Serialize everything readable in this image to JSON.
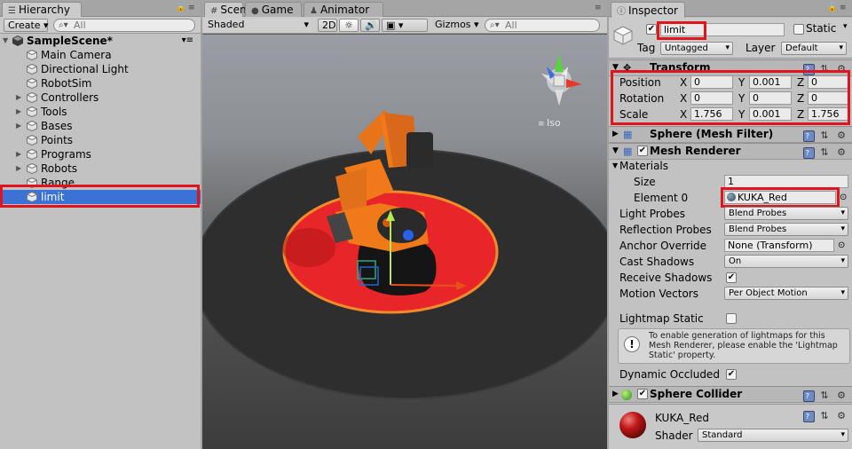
{
  "hierarchy": {
    "tab_label": "Hierarchy",
    "create_label": "Create",
    "search_placeholder": "All",
    "scene_name": "SampleScene*",
    "items": [
      {
        "label": "Main Camera",
        "has_children": false
      },
      {
        "label": "Directional Light",
        "has_children": false
      },
      {
        "label": "RobotSim",
        "has_children": false
      },
      {
        "label": "Controllers",
        "has_children": true
      },
      {
        "label": "Tools",
        "has_children": true
      },
      {
        "label": "Bases",
        "has_children": true
      },
      {
        "label": "Points",
        "has_children": false
      },
      {
        "label": "Programs",
        "has_children": true
      },
      {
        "label": "Robots",
        "has_children": true
      },
      {
        "label": "Range",
        "has_children": false
      },
      {
        "label": "limit",
        "has_children": false,
        "selected": true
      }
    ]
  },
  "scene": {
    "tabs": [
      {
        "label": "Scene",
        "icon": "hash-icon"
      },
      {
        "label": "Game",
        "icon": "gamepad-icon"
      },
      {
        "label": "Animator",
        "icon": "animator-icon"
      }
    ],
    "shading_mode": "Shaded",
    "mode_2d": "2D",
    "gizmos_label": "Gizmos",
    "search_placeholder": "All",
    "projection_label": "Iso"
  },
  "inspector": {
    "tab_label": "Inspector",
    "object_name": "limit",
    "static_label": "Static",
    "tag_label": "Tag",
    "tag_value": "Untagged",
    "layer_label": "Layer",
    "layer_value": "Default",
    "transform": {
      "title": "Transform",
      "rows": [
        {
          "label": "Position",
          "x": "0",
          "y": "0.001",
          "z": "0"
        },
        {
          "label": "Rotation",
          "x": "0",
          "y": "0",
          "z": "0"
        },
        {
          "label": "Scale",
          "x": "1.756",
          "y": "0.001",
          "z": "1.756"
        }
      ]
    },
    "mesh_filter_title": "Sphere (Mesh Filter)",
    "mesh_renderer": {
      "title": "Mesh Renderer",
      "materials_label": "Materials",
      "size_label": "Size",
      "size_value": "1",
      "element_label": "Element 0",
      "element_value": "KUKA_Red",
      "light_probes_label": "Light Probes",
      "light_probes_value": "Blend Probes",
      "reflection_probes_label": "Reflection Probes",
      "reflection_probes_value": "Blend Probes",
      "anchor_override_label": "Anchor Override",
      "anchor_override_value": "None (Transform)",
      "cast_shadows_label": "Cast Shadows",
      "cast_shadows_value": "On",
      "receive_shadows_label": "Receive Shadows",
      "motion_vectors_label": "Motion Vectors",
      "motion_vectors_value": "Per Object Motion",
      "lightmap_static_label": "Lightmap Static",
      "info_line1": "To enable generation of lightmaps for this",
      "info_line2": "Mesh Renderer, please enable the 'Lightmap",
      "info_line3": "Static' property.",
      "dynamic_occluded_label": "Dynamic Occluded"
    },
    "sphere_collider_title": "Sphere Collider",
    "material": {
      "name": "KUKA_Red",
      "shader_label": "Shader",
      "shader_value": "Standard"
    }
  },
  "colors": {
    "highlight_red": "#e1131d",
    "selection_blue": "#3a72d6",
    "robot_orange": "#f07a1a",
    "limit_red": "#e8262a"
  }
}
